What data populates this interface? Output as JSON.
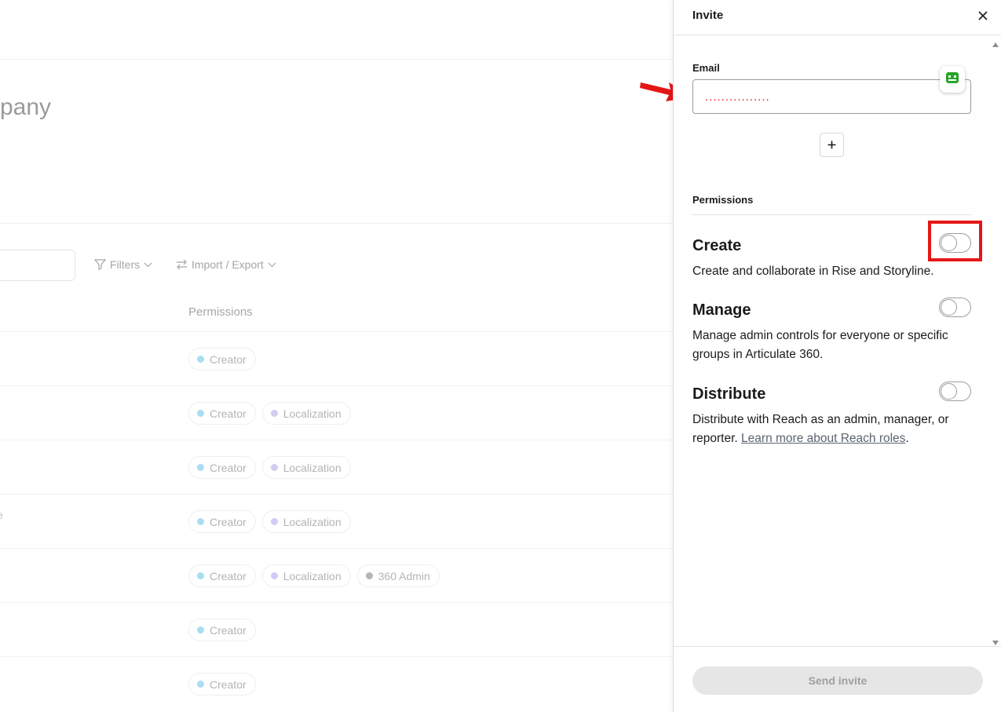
{
  "background": {
    "company_fragment": "pany",
    "toolbar": {
      "filters_label": "Filters",
      "import_export_label": "Import / Export"
    },
    "permissions_column_header": "Permissions",
    "row_fragment": "e",
    "chip_labels": {
      "creator": "Creator",
      "localization": "Localization",
      "admin_360": "360 Admin"
    },
    "chip_colors": {
      "creator": "#a9ddf2",
      "localization": "#d4cbf1",
      "admin_360": "#b5b5b5"
    }
  },
  "panel": {
    "title": "Invite",
    "email": {
      "label": "Email",
      "value": "................"
    },
    "permissions_heading": "Permissions",
    "permissions": [
      {
        "title": "Create",
        "description": "Create and collaborate in Rise and Storyline.",
        "enabled": false
      },
      {
        "title": "Manage",
        "description": "Manage admin controls for everyone or specific groups in Articulate 360.",
        "enabled": false
      },
      {
        "title": "Distribute",
        "description": "Distribute with Reach as an admin, manager, or reporter.",
        "link": "Learn more about Reach roles",
        "suffix": ".",
        "enabled": false
      }
    ],
    "send_label": "Send invite"
  },
  "icons": [
    "close-icon",
    "plus-icon",
    "password-manager-icon",
    "filter-icon",
    "swap-icon",
    "chevron-down-icon",
    "scroll-up-icon",
    "scroll-down-icon",
    "red-arrow-annotation"
  ],
  "colors": {
    "annotation_red": "#e51616",
    "email_text": "#e02020",
    "password_icon_green": "#2aa52a"
  }
}
